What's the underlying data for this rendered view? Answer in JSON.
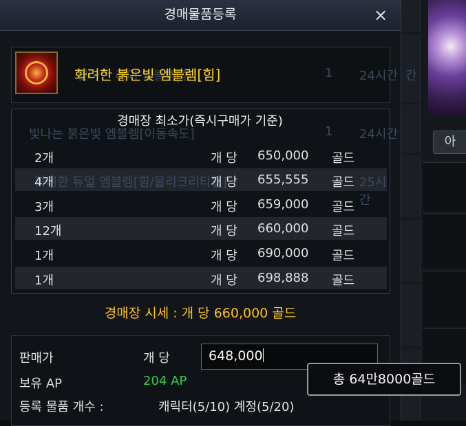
{
  "background": {
    "tab_label": "아",
    "ghost_rows": [
      {
        "name": "빛나는 레어 엠블렘[힘]",
        "qty": "1",
        "time": "24시간"
      },
      {
        "name": "빛나는 붉은빛 엠블렘[이동속도]",
        "qty": "1",
        "time": "24시간"
      },
      {
        "name": "화려한 듀얼 엠블렘[힘/물리크리티컬]",
        "qty": "",
        "time": "25시간"
      }
    ],
    "right_edge_text": "간"
  },
  "dialog": {
    "title": "경매물품등록",
    "close_label": "×",
    "item": {
      "icon": "red-emblem-icon",
      "name": "화려한 붉은빛 엠블렘[힘]"
    },
    "lowest_price": {
      "title": "경매장 최소가(즉시구매가 기준)",
      "rows": [
        {
          "qty": "2개",
          "per": "개 당",
          "price": "650,000",
          "unit": "골드"
        },
        {
          "qty": "4개",
          "per": "개 당",
          "price": "655,555",
          "unit": "골드"
        },
        {
          "qty": "3개",
          "per": "개 당",
          "price": "659,000",
          "unit": "골드"
        },
        {
          "qty": "12개",
          "per": "개 당",
          "price": "660,000",
          "unit": "골드"
        },
        {
          "qty": "1개",
          "per": "개 당",
          "price": "690,000",
          "unit": "골드"
        },
        {
          "qty": "1개",
          "per": "개 당",
          "price": "698,888",
          "unit": "골드"
        }
      ]
    },
    "market_price": "경매장 시세 : 개 당 660,000 골드",
    "sell": {
      "price_label": "판매가",
      "per_label": "개 당",
      "price_value": "648,000",
      "ap_label": "보유 AP",
      "ap_value": "204 AP",
      "count_label": "등록 물품 개수 :",
      "count_value": "캐릭터(5/10) 계정(5/20)"
    },
    "tooltip": "총 64만8000골드"
  },
  "colors": {
    "item_name": "#ffd21e",
    "market_price": "#ffc21a",
    "ap_value": "#2fd04a"
  }
}
